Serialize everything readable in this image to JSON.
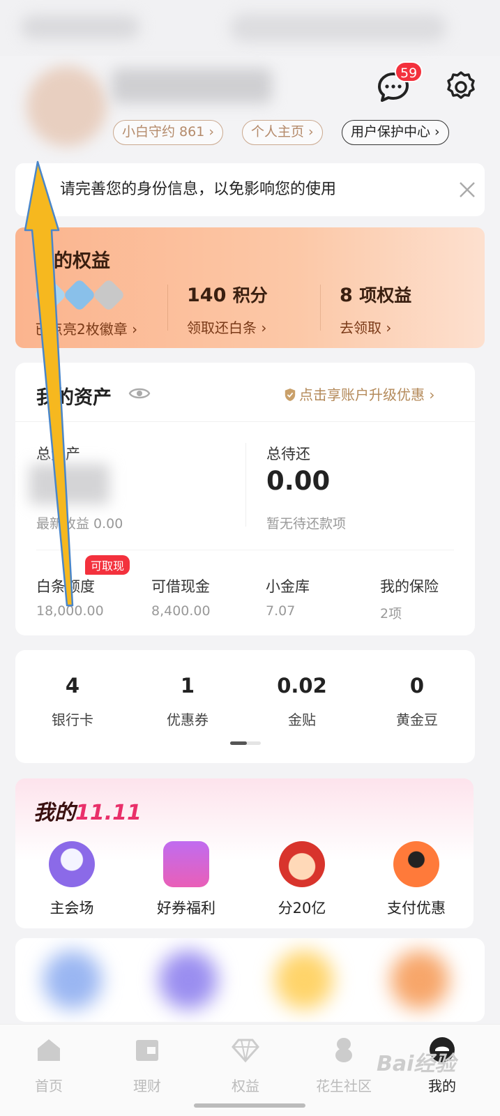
{
  "header": {
    "message_badge_count": "59",
    "pills": [
      "小白守约 861 ›",
      "个人主页 ›",
      "用户保护中心 ›"
    ]
  },
  "notice": {
    "text": "请完善您的身份信息，以免影响您的使用"
  },
  "rights": {
    "title": "我的权益",
    "badges_link": "已点亮2枚徽章 ›",
    "points_value": "140",
    "points_unit": "积分",
    "points_link": "领取还白条 ›",
    "benefits_value": "8",
    "benefits_unit": "项权益",
    "benefits_link": "去领取 ›"
  },
  "assets": {
    "title": "我的资产",
    "upgrade_link": "点击享账户升级优惠 ›",
    "total_assets_label": "总资产",
    "latest_income": "最新收益 0.00",
    "total_due_label": "总待还",
    "total_due_value": "0.00",
    "no_due_text": "暂无待还款项",
    "items": [
      {
        "label": "白条额度",
        "value": "18,000.00",
        "tag": "可取现"
      },
      {
        "label": "可借现金",
        "value": "8,400.00"
      },
      {
        "label": "小金库",
        "value": "7.07"
      },
      {
        "label": "我的保险",
        "value": "2项"
      }
    ]
  },
  "stats": [
    {
      "value": "4",
      "label": "银行卡"
    },
    {
      "value": "1",
      "label": "优惠券"
    },
    {
      "value": "0.02",
      "label": "金贴"
    },
    {
      "value": "0",
      "label": "黄金豆"
    }
  ],
  "promo": {
    "title_prefix": "我的",
    "title_highlight": "11.11",
    "items": [
      {
        "label": "主会场",
        "icon": "duck-mascot-icon"
      },
      {
        "label": "好券福利",
        "icon": "coupon-gift-icon"
      },
      {
        "label": "分20亿",
        "icon": "princess-mascot-icon"
      },
      {
        "label": "支付优惠",
        "icon": "sunglasses-mascot-icon"
      }
    ]
  },
  "tabbar": [
    {
      "label": "首页",
      "icon": "home-icon"
    },
    {
      "label": "理财",
      "icon": "wallet-icon"
    },
    {
      "label": "权益",
      "icon": "diamond-icon"
    },
    {
      "label": "花生社区",
      "icon": "peanut-icon"
    },
    {
      "label": "我的",
      "icon": "profile-icon",
      "active": true
    }
  ],
  "watermark": "Bai经验",
  "colors": {
    "accent": "#f3313d",
    "gold": "#b48a5a",
    "rights_bg": "#fbb48e"
  }
}
